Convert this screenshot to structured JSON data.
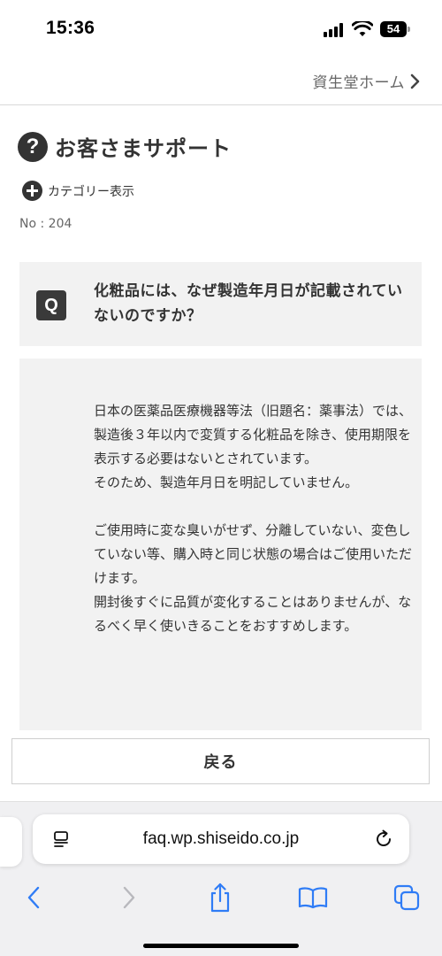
{
  "status_bar": {
    "time": "15:36",
    "battery": "54"
  },
  "header": {
    "home_link": "資生堂ホーム"
  },
  "support": {
    "icon_glyph": "?",
    "title": "お客さまサポート",
    "category_label": "カテゴリー表示",
    "faq_number": "No : 204"
  },
  "question": {
    "badge": "Q",
    "text": "化粧品には、なぜ製造年月日が記載されていないのですか？"
  },
  "answer": {
    "paragraphs": [
      "日本の医薬品医療機器等法（旧題名：薬事法）では、製造後３年以内で変質する化粧品を除き、使用期限を表示する必要はないとされています。",
      "そのため、製造年月日を明記していません。",
      "",
      "ご使用時に変な臭いがせず、分離していない、変色していない等、購入時と同じ状態の場合はご使用いただけます。",
      "開封後すぐに品質が変化することはありませんが、なるべく早く使いきることをおすすめします。"
    ]
  },
  "back_button": {
    "label": "戻る"
  },
  "browser": {
    "url": "faq.wp.shiseido.co.jp",
    "accent_color": "#2f7cf6",
    "disabled_color": "#b8b8bd"
  }
}
